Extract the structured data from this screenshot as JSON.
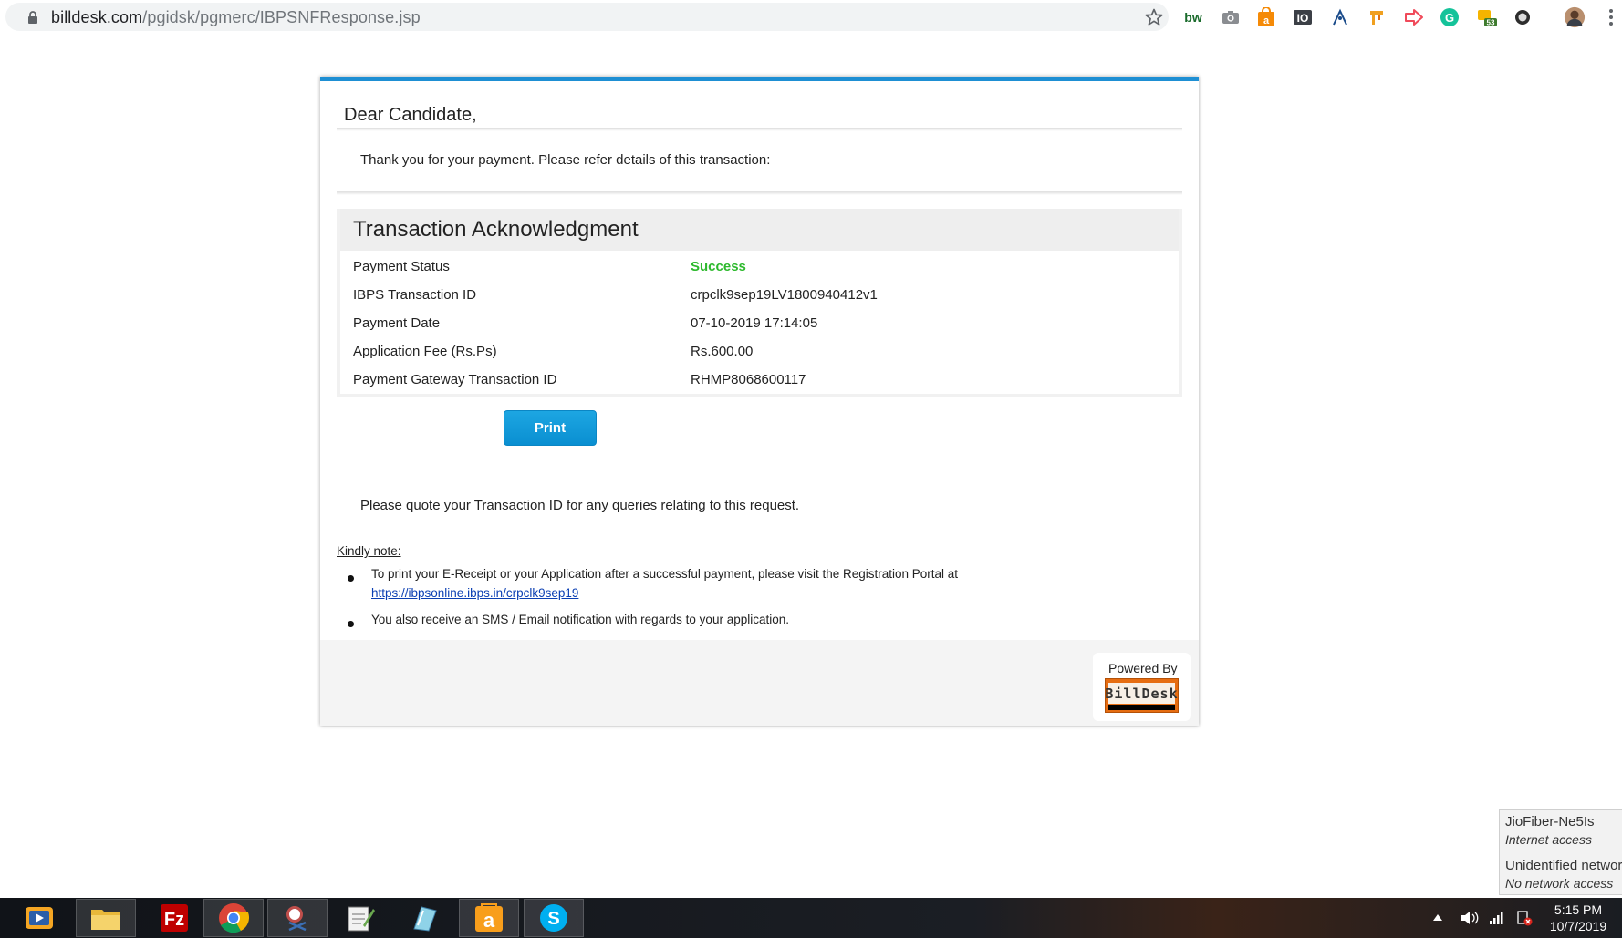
{
  "browser": {
    "url_host": "billdesk.com",
    "url_path": "/pgidsk/pgmerc/IBPSNFResponse.jsp",
    "extensions": [
      "bw-icon",
      "camera-icon",
      "shopping-bag-icon",
      "io-icon",
      "pen-tool-icon",
      "bookmark-tool-icon",
      "arrow-icon",
      "grammarly-icon",
      "counter-icon",
      "circle-icon",
      "profile-avatar"
    ],
    "ext_badge": "53"
  },
  "page": {
    "greeting": "Dear Candidate,",
    "thanks": "Thank you for your payment. Please refer details of this transaction:",
    "ack_title": "Transaction Acknowledgment",
    "rows": [
      {
        "label": "Payment Status",
        "value": "Success"
      },
      {
        "label": "IBPS Transaction ID",
        "value": "crpclk9sep19LV1800940412v1"
      },
      {
        "label": "Payment Date",
        "value": "07-10-2019 17:14:05"
      },
      {
        "label": "Application Fee (Rs.Ps)",
        "value": "Rs.600.00"
      },
      {
        "label": "Payment Gateway Transaction ID",
        "value": "RHMP8068600117"
      }
    ],
    "print_label": "Print",
    "quote": "Please quote your Transaction ID for any queries relating to this request.",
    "kindly_note": "Kindly note:",
    "note1": "To print your E-Receipt or your Application after a successful payment, please visit the Registration Portal at",
    "note1_link": "https://ibpsonline.ibps.in/crpclk9sep19",
    "note2": "You also receive an SMS / Email notification with regards to your application.",
    "powered_by": "Powered By",
    "logo_text": "BillDesk"
  },
  "network": {
    "net1_name": "JioFiber-Ne5Is",
    "net1_status": "Internet access",
    "net2_name": "Unidentified networ",
    "net2_status": "No network access"
  },
  "taskbar": {
    "apps": [
      "media-player",
      "file-explorer",
      "filezilla",
      "chrome",
      "snipping-tool",
      "notepad-plus",
      "paint-app",
      "amazon-app",
      "skype"
    ],
    "time": "5:15 PM",
    "date": "10/7/2019"
  },
  "colors": {
    "accent": "#1e8fd3",
    "success": "#2db92d",
    "link": "#0b3fb3"
  }
}
